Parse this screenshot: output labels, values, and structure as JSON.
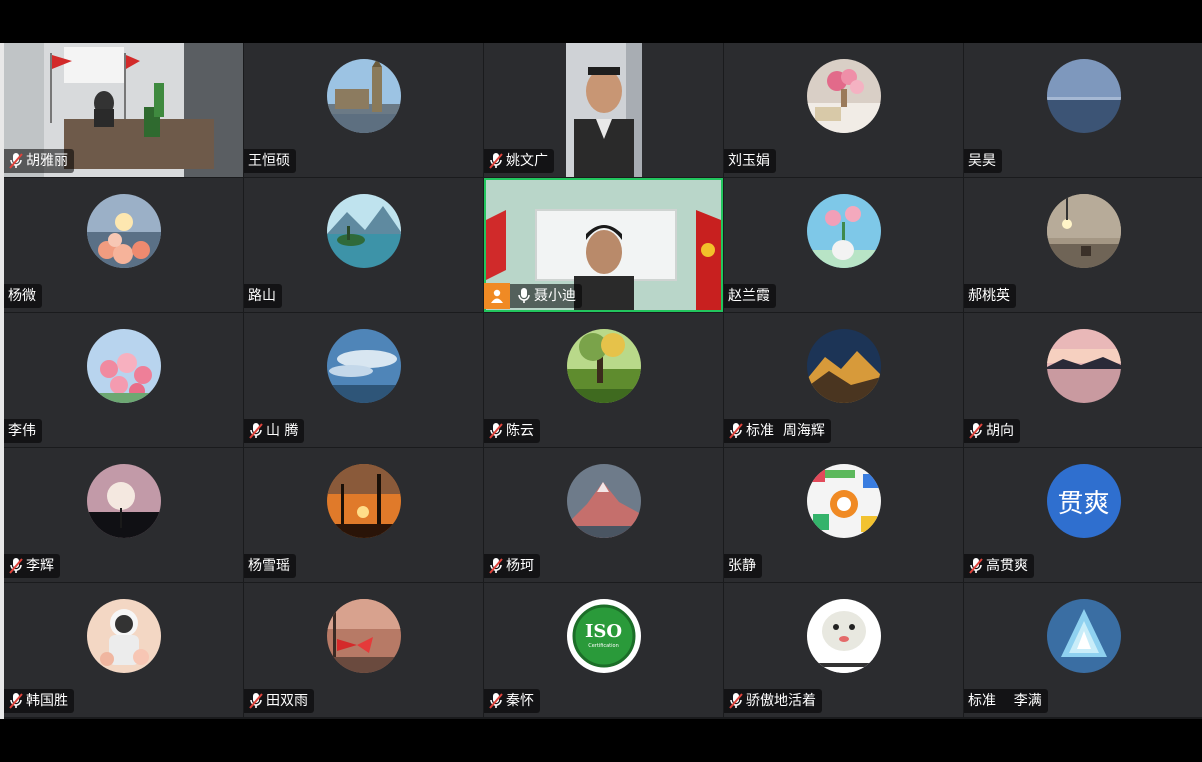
{
  "participants": [
    {
      "name": "胡雅丽",
      "muted": true,
      "kind": "video-office"
    },
    {
      "name": "王恒硕",
      "muted": false,
      "kind": "avatar-bigben"
    },
    {
      "name": "姚文广",
      "muted": true,
      "kind": "video-portrait"
    },
    {
      "name": "刘玉娟",
      "muted": false,
      "kind": "avatar-flowers-table"
    },
    {
      "name": "吴昊",
      "muted": false,
      "kind": "avatar-sea"
    },
    {
      "name": "杨微",
      "muted": false,
      "kind": "avatar-tulips"
    },
    {
      "name": "路山",
      "muted": false,
      "kind": "avatar-lake"
    },
    {
      "name": "聂小迪",
      "muted": false,
      "speaking": true,
      "kind": "video-flags"
    },
    {
      "name": "赵兰霞",
      "muted": false,
      "kind": "avatar-vase"
    },
    {
      "name": "郝桃英",
      "muted": false,
      "kind": "avatar-room"
    },
    {
      "name": "李伟",
      "muted": false,
      "kind": "avatar-roses"
    },
    {
      "name": "山 腾",
      "muted": true,
      "kind": "avatar-sky"
    },
    {
      "name": "陈云",
      "muted": true,
      "kind": "avatar-tree"
    },
    {
      "name": "标准  周海辉",
      "muted": true,
      "kind": "avatar-mountain-gold"
    },
    {
      "name": "胡向",
      "muted": true,
      "kind": "avatar-sunset-lake"
    },
    {
      "name": "李辉",
      "muted": true,
      "kind": "avatar-dandelion"
    },
    {
      "name": "杨雪瑶",
      "muted": false,
      "kind": "avatar-orange-sunset"
    },
    {
      "name": "杨珂",
      "muted": true,
      "kind": "avatar-peak"
    },
    {
      "name": "张静",
      "muted": false,
      "kind": "avatar-colorful"
    },
    {
      "name": "高贯爽",
      "muted": true,
      "kind": "avatar-text",
      "avatar_text": "贯爽",
      "avatar_color": "#2f6fcf"
    },
    {
      "name": "韩国胜",
      "muted": true,
      "kind": "avatar-astronaut"
    },
    {
      "name": "田双雨",
      "muted": true,
      "kind": "avatar-ribbon"
    },
    {
      "name": "秦怀",
      "muted": true,
      "kind": "avatar-iso",
      "logo_text": "ISO",
      "logo_sub": "Certification"
    },
    {
      "name": "骄傲地活着",
      "muted": true,
      "kind": "avatar-meme"
    },
    {
      "name": "标准    李满",
      "muted": false,
      "kind": "avatar-crystal"
    }
  ],
  "colors": {
    "tile": "#2b2c2f",
    "speaking_border": "#22c55e",
    "muted_icon": "#e0433b",
    "badge": "#f08a24"
  },
  "icons": {
    "muted": "mic-muted-icon",
    "mic": "mic-icon",
    "person": "person-icon"
  }
}
